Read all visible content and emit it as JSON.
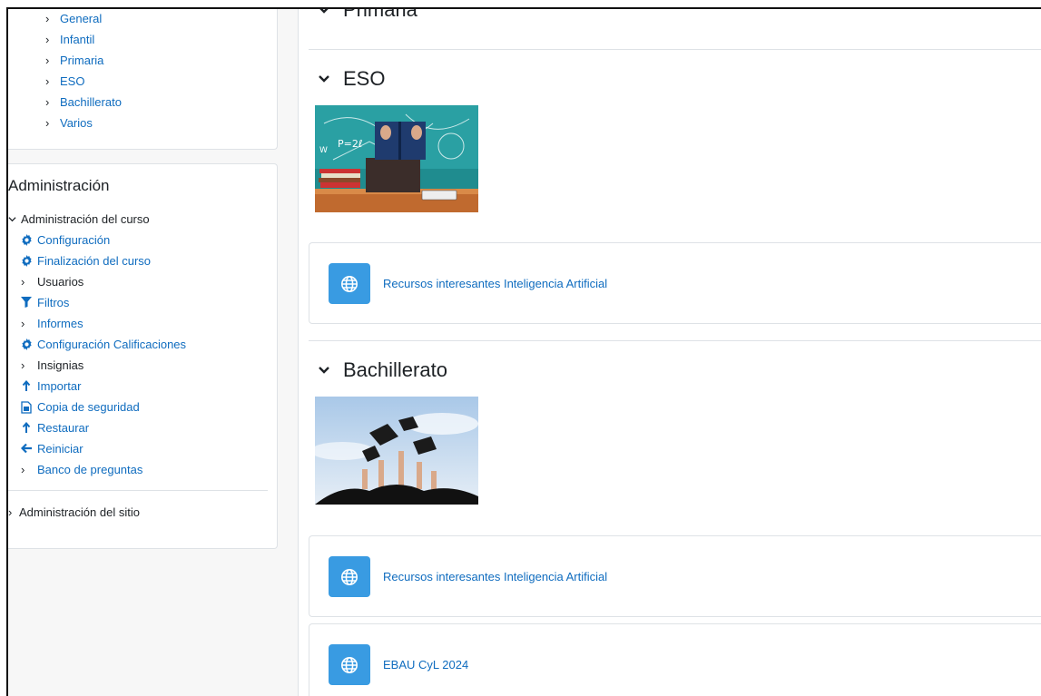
{
  "sidebar": {
    "course_nav": [
      {
        "label": "General"
      },
      {
        "label": "Infantil"
      },
      {
        "label": "Primaria"
      },
      {
        "label": "ESO"
      },
      {
        "label": "Bachillerato"
      },
      {
        "label": "Varios"
      }
    ],
    "admin": {
      "title": "Administración",
      "course_admin_label": "Administración del curso",
      "items": [
        {
          "label": "Configuración",
          "icon": "gear-icon"
        },
        {
          "label": "Finalización del curso",
          "icon": "gear-icon"
        },
        {
          "label": "Usuarios",
          "icon": "chevron-right-icon"
        },
        {
          "label": "Filtros",
          "icon": "filter-icon"
        },
        {
          "label": "Informes",
          "icon": "chevron-right-icon"
        },
        {
          "label": "Configuración Calificaciones",
          "icon": "gear-icon"
        },
        {
          "label": "Insignias",
          "icon": "chevron-right-icon"
        },
        {
          "label": "Importar",
          "icon": "upload-icon"
        },
        {
          "label": "Copia de seguridad",
          "icon": "file-backup-icon"
        },
        {
          "label": "Restaurar",
          "icon": "upload-icon"
        },
        {
          "label": "Reiniciar",
          "icon": "arrow-left-icon"
        },
        {
          "label": "Banco de preguntas",
          "icon": "chevron-right-icon"
        }
      ],
      "site_admin_label": "Administración del sitio"
    }
  },
  "main": {
    "sections": [
      {
        "title": "Primaria"
      },
      {
        "title": "ESO"
      },
      {
        "title": "Bachillerato"
      }
    ],
    "activities": [
      {
        "label": "Recursos interesantes Inteligencia Artificial"
      },
      {
        "label": "Recursos interesantes Inteligencia Artificial"
      },
      {
        "label": "EBAU CyL 2024"
      }
    ]
  },
  "colors": {
    "link": "#0f6cbf",
    "activity_icon_bg": "#399be2",
    "border": "#dee2e6",
    "sidebar_bg": "#f7f7f7"
  }
}
